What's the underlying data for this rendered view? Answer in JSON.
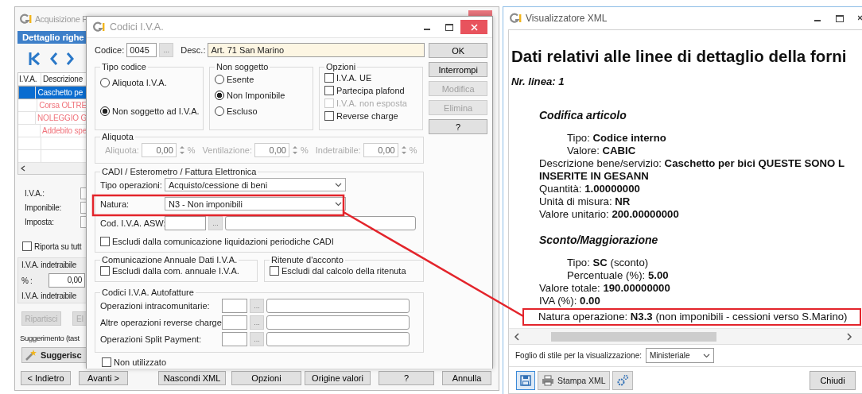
{
  "main_window": {
    "title": "Acquisizione F",
    "panel_title": "Dettaglio righe",
    "table": {
      "columns": [
        "I.V.A.",
        "Descrizione"
      ],
      "rows": [
        {
          "descrizione": "Caschetto pe",
          "selected": true,
          "alert": false
        },
        {
          "descrizione": "Corsa OLTRE",
          "selected": false,
          "alert": true
        },
        {
          "descrizione": "NOLEGGIO G",
          "selected": false,
          "alert": true
        },
        {
          "descrizione": "Addebito spe",
          "selected": false,
          "alert": true
        }
      ]
    },
    "fields": [
      {
        "label": "I.V.A.:"
      },
      {
        "label": "Imponibile:"
      },
      {
        "label": "Imposta:"
      }
    ],
    "apply_all": {
      "label": "Riporta su tutt",
      "checked": false
    },
    "indetraibile": {
      "title": "I.V.A. indetraibile",
      "percent_label": "% :",
      "percent_value": "0,00",
      "amount_label": "I.V.A. indetraibile"
    },
    "action_buttons": [
      {
        "label": "Ripartisci",
        "disabled": true
      },
      {
        "label": "El",
        "disabled": true
      }
    ],
    "suggestion": {
      "title": "Suggerimento (tast",
      "button": "Suggerisc"
    },
    "footer_buttons": [
      {
        "label": "< Indietro"
      },
      {
        "label": "Avanti >"
      },
      {
        "label": "Nascondi XML"
      },
      {
        "label": "Opzioni"
      },
      {
        "label": "Origine valori"
      },
      {
        "label": "?"
      },
      {
        "label": "Annulla"
      }
    ]
  },
  "dialog": {
    "title": "Codici I.V.A.",
    "codice_label": "Codice:",
    "codice_value": "0045",
    "codice_browse": "...",
    "desc_label": "Desc.:",
    "desc_value": "Art. 71 San Marino",
    "tipo_codice": {
      "title": "Tipo codice",
      "options": [
        {
          "label": "Aliquota I.V.A.",
          "selected": false
        },
        {
          "label": "Non soggetto ad I.V.A.",
          "selected": true
        }
      ]
    },
    "non_soggetto": {
      "title": "Non soggetto",
      "options": [
        {
          "label": "Esente",
          "selected": false
        },
        {
          "label": "Non Imponibile",
          "selected": true
        },
        {
          "label": "Escluso",
          "selected": false
        }
      ]
    },
    "opzioni": {
      "title": "Opzioni",
      "items": [
        {
          "label": "I.V.A. UE",
          "checked": false,
          "disabled": false
        },
        {
          "label": "Partecipa plafond",
          "checked": false,
          "disabled": false
        },
        {
          "label": "I.V.A. non esposta",
          "checked": false,
          "disabled": true
        },
        {
          "label": "Reverse charge",
          "checked": false,
          "disabled": false
        }
      ]
    },
    "aliquota": {
      "title": "Aliquota",
      "disabled": true,
      "fields": [
        {
          "label": "Aliquota:",
          "value": "0,00",
          "unit": "%"
        },
        {
          "label": "Ventilazione:",
          "value": "0,00",
          "unit": "%"
        },
        {
          "label": "Indetraibile:",
          "value": "0,00",
          "unit": "%"
        }
      ]
    },
    "cadi": {
      "title": "CADI / Esterometro / Fattura Elettronica",
      "tipo_label": "Tipo operazioni:",
      "tipo_value": "Acquisto/cessione di beni",
      "natura_label": "Natura:",
      "natura_value": "N3 - Non imponibili",
      "asw_label": "Cod. I.V.A. ASW:",
      "asw_browse": "...",
      "exclude": {
        "label": "Escludi dalla comunicazione liquidazioni periodiche CADI",
        "checked": false
      }
    },
    "comunicazione": {
      "title": "Comunicazione Annuale Dati I.V.A.",
      "item": {
        "label": "Escludi dalla com. annuale I.V.A.",
        "checked": false
      }
    },
    "ritenute": {
      "title": "Ritenute d'acconto",
      "item": {
        "label": "Escludi dal calcolo della ritenuta",
        "checked": false
      }
    },
    "autofatture": {
      "title": "Codici I.V.A. Autofatture",
      "rows": [
        {
          "label": "Operazioni intracomunitarie:",
          "browse": "..."
        },
        {
          "label": "Altre operazioni reverse charge:",
          "browse": "..."
        },
        {
          "label": "Operazioni Split Payment:",
          "browse": "..."
        }
      ]
    },
    "unused": {
      "label": "Non utilizzato",
      "checked": false
    },
    "buttons": [
      {
        "label": "OK",
        "disabled": false
      },
      {
        "label": "Interrompi",
        "disabled": false
      },
      {
        "label": "Modifica",
        "disabled": true
      },
      {
        "label": "Elimina",
        "disabled": true
      },
      {
        "label": "?",
        "disabled": false
      }
    ]
  },
  "xml_viewer": {
    "title": "Visualizzatore XML",
    "heading": "Dati relativi alle linee di dettaglio della forni",
    "line_number": "Nr. linea: 1",
    "sections": [
      {
        "title": "Codifica articolo",
        "children": [
          {
            "label": "Tipo:",
            "value": "Codice interno"
          },
          {
            "label": "Valore:",
            "value": "CABIC"
          }
        ],
        "lines": [
          {
            "label": "Descrizione bene/servizio:",
            "value": "Caschetto per bici QUESTE SONO L"
          },
          {
            "value": "INSERITE IN GESANN"
          },
          {
            "label": "Quantità:",
            "value": "1.00000000"
          },
          {
            "label": "Unità di misura:",
            "value": "NR"
          },
          {
            "label": "Valore unitario:",
            "value": "200.00000000"
          }
        ]
      },
      {
        "title": "Sconto/Maggiorazione",
        "children": [
          {
            "label": "Tipo:",
            "value": "SC",
            "note": "(sconto)"
          },
          {
            "label": "Percentuale (%):",
            "value": "5.00"
          }
        ],
        "lines": [
          {
            "label": "Valore totale:",
            "value": "190.00000000"
          },
          {
            "label": "IVA (%):",
            "value": "0.00"
          },
          {
            "label": "Natura operazione:",
            "value": "N3.3",
            "note": "(non imponibili - cessioni verso S.Marino)",
            "callout": true
          }
        ]
      }
    ],
    "stylesheet_label": "Foglio di stile per la visualizzazione:",
    "stylesheet_value": "Ministeriale",
    "toolbar": [
      {
        "kind": "save"
      },
      {
        "kind": "print",
        "label": "Stampa XML"
      },
      {
        "kind": "settings"
      }
    ],
    "close_button": "Chiudi"
  }
}
